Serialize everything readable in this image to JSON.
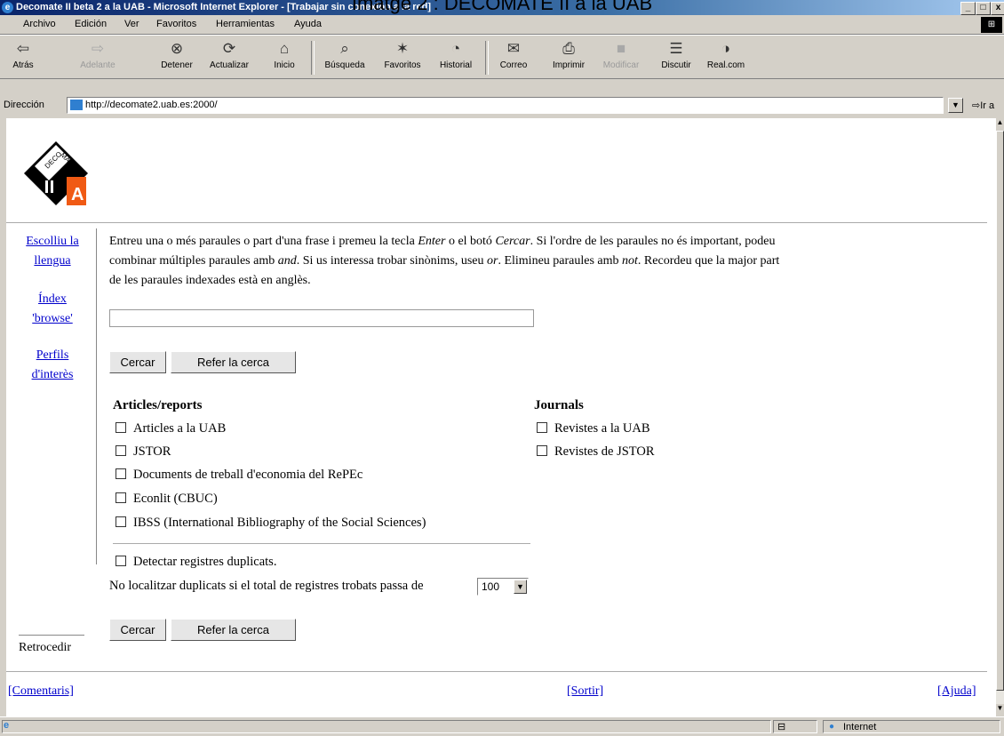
{
  "caption": "Imatge 2 : DECOMATE II a la UAB",
  "window": {
    "title": "Decomate II beta 2 a la UAB - Microsoft Internet Explorer - [Trabajar sin conexión a la red]",
    "minimize": "_",
    "maximize": "□",
    "close": "x"
  },
  "menu": [
    "Archivo",
    "Edición",
    "Ver",
    "Favoritos",
    "Herramientas",
    "Ayuda"
  ],
  "toolbar": {
    "back": "Atrás",
    "forward": "Adelante",
    "stop": "Detener",
    "refresh": "Actualizar",
    "home": "Inicio",
    "search": "Búsqueda",
    "favorites": "Favoritos",
    "history": "Historial",
    "mail": "Correo",
    "print": "Imprimir",
    "edit": "Modificar",
    "discuss": "Discutir",
    "realcom": "Real.com"
  },
  "address": {
    "label": "Dirección",
    "url": "http://decomate2.uab.es:2000/",
    "go": "Ir a"
  },
  "logo": {
    "text_top": "DECOMATE",
    "text_bottom": "IIA"
  },
  "sidebar": {
    "lang_line1": "Escolliu la",
    "lang_line2": "llengua",
    "index_line1": "Índex",
    "index_line2": "'browse'",
    "profiles_line1": "Perfils",
    "profiles_line2": "d'interès",
    "back": "Retrocedir"
  },
  "intro": {
    "p1": "Entreu una o més paraules o part d'una frase i premeu la tecla ",
    "enter": "Enter",
    "p2": " o el botó ",
    "cercar": "Cercar",
    "p3": ". Si l'ordre de les paraules no és important, podeu combinar múltiples paraules amb ",
    "and": "and",
    "p4": ". Si us interessa trobar sinònims, useu ",
    "or": "or",
    "p5": ". Elimineu paraules amb ",
    "not": "not",
    "p6": ". Recordeu que la major part de les paraules indexades està en anglès."
  },
  "search": {
    "value": "",
    "search_button": "Cercar",
    "reset_button": "Refer la cerca"
  },
  "sources": {
    "articles_heading": "Articles/reports",
    "articles": [
      "Articles a la UAB",
      "JSTOR",
      "Documents de treball d'economia del RePEc",
      "Econlit (CBUC)",
      "IBSS (International Bibliography of the Social Sciences)"
    ],
    "journals_heading": "Journals",
    "journals": [
      "Revistes a la UAB",
      "Revistes de JSTOR"
    ]
  },
  "duplicates": {
    "detect": "Detectar registres duplicats.",
    "limit_text": "No localitzar duplicats si el total de registres trobats passa de",
    "limit_value": "100"
  },
  "footer": {
    "comments": "[Comentaris]",
    "exit": "[Sortir]",
    "help": "[Ajuda]"
  },
  "statusbar": {
    "zone": "Internet"
  }
}
